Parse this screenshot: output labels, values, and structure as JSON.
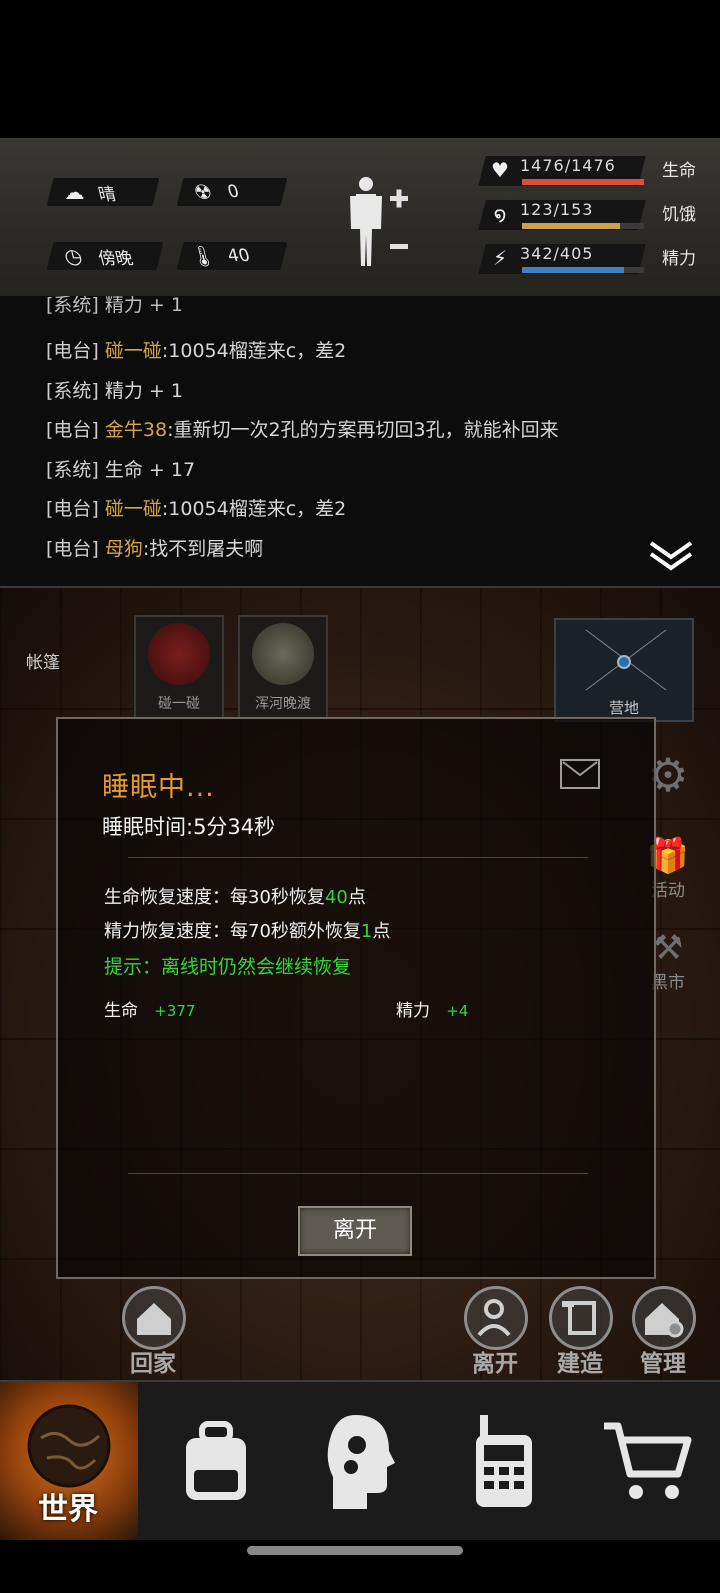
{
  "status": {
    "weather": {
      "icon": "cloud-sun-icon",
      "label": "晴"
    },
    "radiation": {
      "icon": "radiation-icon",
      "value": "0"
    },
    "time_of_day": {
      "icon": "clock-icon",
      "label": "傍晚"
    },
    "temperature": {
      "icon": "thermometer-icon",
      "value": "40"
    },
    "stats": [
      {
        "icon": "heart-icon",
        "value": "1476/1476",
        "name": "生命",
        "fraction": 1.0,
        "color": "#d9503b"
      },
      {
        "icon": "stomach-icon",
        "value": "123/153",
        "name": "饥饿",
        "fraction": 0.8,
        "color": "#caa24d"
      },
      {
        "icon": "head-bolt-icon",
        "value": "342/405",
        "name": "精力",
        "fraction": 0.84,
        "color": "#3f82c4"
      }
    ]
  },
  "log": {
    "partial_line": "[系统] 精力 + 1",
    "lines": [
      {
        "tag": "[电台]",
        "who": "碰一碰",
        "text": ":10054榴莲来c，差2"
      },
      {
        "tag": "[系统]",
        "who": "",
        "text": "精力 + 1"
      },
      {
        "tag": "[电台]",
        "who": "金牛38",
        "text": ":重新切一次2孔的方案再切回3孔，就能补回来"
      },
      {
        "tag": "[系统]",
        "who": "",
        "text": "生命 + 17"
      },
      {
        "tag": "[电台]",
        "who": "碰一碰",
        "text": ":10054榴莲来c，差2"
      },
      {
        "tag": "[电台]",
        "who": "母狗",
        "text": ":找不到屠夫啊"
      }
    ]
  },
  "scene": {
    "location": "帐篷",
    "players": [
      {
        "name": "碰一碰"
      },
      {
        "name": "浑河晚渡"
      }
    ],
    "minimap_label": "营地",
    "side_activity": "活动",
    "side_market": "黑市"
  },
  "modal": {
    "title": "睡眠中...",
    "sleep_time": "睡眠时间:5分34秒",
    "hp_rate_prefix": "生命恢复速度：每30秒恢复",
    "hp_rate_value": "40",
    "hp_rate_suffix": "点",
    "sp_rate_prefix": "精力恢复速度：每70秒额外恢复",
    "sp_rate_value": "1",
    "sp_rate_suffix": "点",
    "hint": "提示：离线时仍然会继续恢复",
    "hp_label": "生命",
    "hp_gain": "+377",
    "sp_label": "精力",
    "sp_gain": "+4",
    "leave_button": "离开"
  },
  "actions": {
    "home": "回家",
    "leave": "离开",
    "build": "建造",
    "manage": "管理"
  },
  "nav": {
    "world": "世界",
    "items": [
      "backpack-icon",
      "brain-icon",
      "radio-icon",
      "cart-icon"
    ]
  }
}
